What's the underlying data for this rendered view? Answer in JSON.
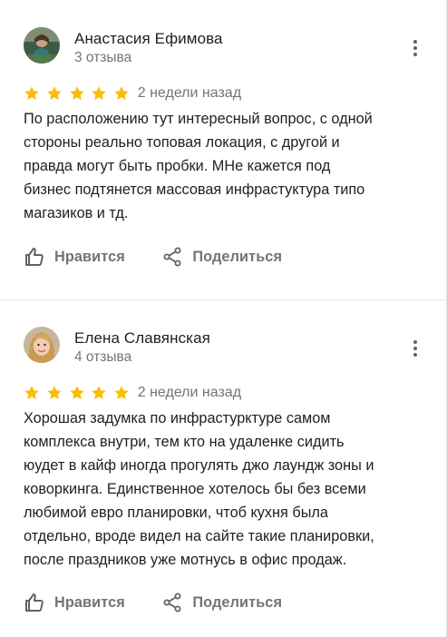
{
  "reviews": [
    {
      "author": "Анастасия Ефимова",
      "review_count": "3 отзыва",
      "rating": 5,
      "date": "2 недели назад",
      "text": "По расположению тут интересный вопрос, с одной\nстороны реально топовая локация, с другой и\nправда могут быть пробки.  МНе кажется под\nбизнес подтянется массовая инфрастуктура типо\nмагазиков и тд.",
      "like_label": "Нравится",
      "share_label": "Поделиться"
    },
    {
      "author": "Елена Славянская",
      "review_count": "4 отзыва",
      "rating": 5,
      "date": "2 недели назад",
      "text": "Хорошая задумка по инфрастурктуре самом\nкомплекса внутри, тем кто на удаленке сидить\nюудет в кайф иногда прогулять джо лаундж зоны и\nковоркинга. Единственное хотелось бы без всеми\nлюбимой евро планировки, чтоб кухня была\nотдельно, вроде видел на сайте такие планировки,\nпосле праздников уже мотнусь в офис продаж.",
      "like_label": "Нравится",
      "share_label": "Поделиться"
    }
  ],
  "colors": {
    "star": "#fbbc04",
    "text": "#202124",
    "secondary_text": "#70757a",
    "icon": "#5f6368",
    "divider": "#e6e6e6"
  },
  "icons": {
    "star": "star-icon",
    "more": "more-vert-icon",
    "like": "thumb-up-icon",
    "share": "share-icon"
  }
}
